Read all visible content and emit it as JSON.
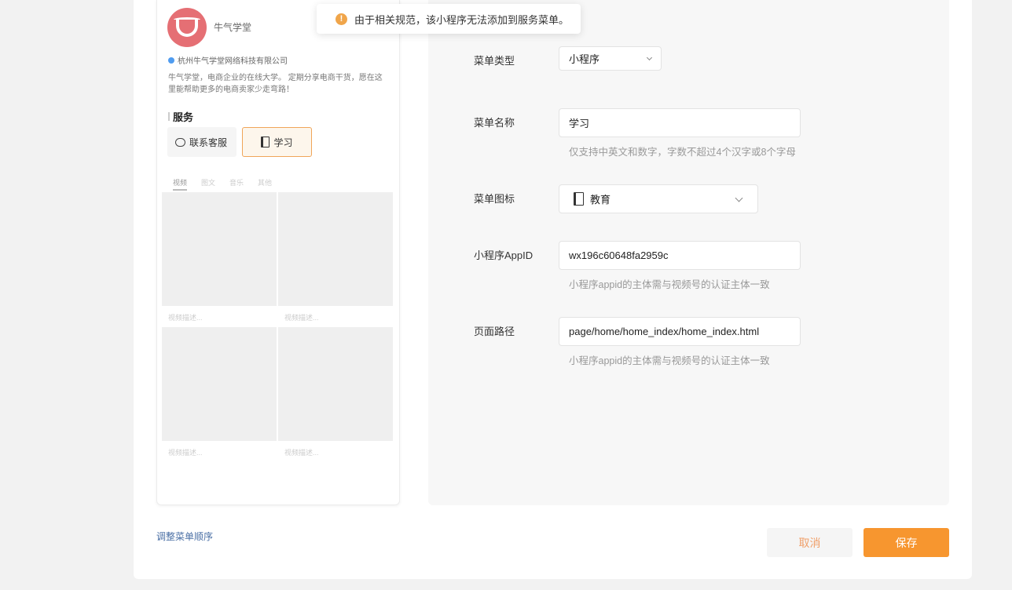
{
  "toast": {
    "message": "由于相关规范，该小程序无法添加到服务菜单。"
  },
  "preview": {
    "account_name": "牛气学堂",
    "company": "杭州牛气学堂网络科技有限公司",
    "description": "牛气学堂，电商企业的在线大学。 定期分享电商干货，愿在这里能帮助更多的电商卖家少走弯路！",
    "services_title": "服务",
    "services": [
      {
        "label": "联系客服",
        "icon": "chat-icon"
      },
      {
        "label": "学习",
        "icon": "book-icon"
      }
    ],
    "tabs": [
      "视频",
      "图文",
      "音乐",
      "其他"
    ],
    "tiles": [
      "视频描述...",
      "视频描述...",
      "视频描述...",
      "视频描述..."
    ],
    "brand_color": "#e56f74"
  },
  "form": {
    "menu_type": {
      "label": "菜单类型",
      "value": "小程序"
    },
    "menu_name": {
      "label": "菜单名称",
      "value": "学习",
      "hint": "仅支持中英文和数字，字数不超过4个汉字或8个字母"
    },
    "menu_icon": {
      "label": "菜单图标",
      "value": "教育",
      "icon": "book-icon"
    },
    "appid": {
      "label": "小程序AppID",
      "value": "wx196c60648fa2959c",
      "hint": "小程序appid的主体需与视频号的认证主体一致"
    },
    "page_path": {
      "label": "页面路径",
      "value": "page/home/home_index/home_index.html",
      "hint": "小程序appid的主体需与视频号的认证主体一致"
    }
  },
  "footer": {
    "reorder_label": "调整菜单顺序",
    "cancel_label": "取消",
    "save_label": "保存"
  },
  "colors": {
    "accent": "#f7962f",
    "warning": "#f0a54a",
    "link": "#4a6fa5"
  }
}
